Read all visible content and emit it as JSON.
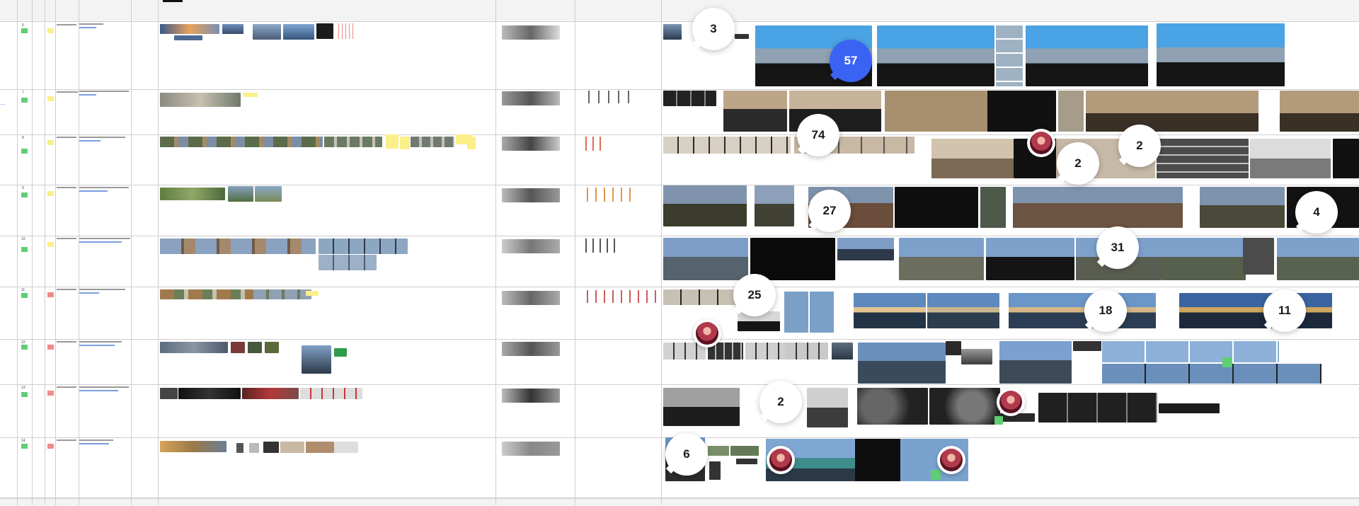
{
  "board": {
    "rows": [
      {
        "label": "6"
      },
      {
        "label": "7"
      },
      {
        "label": "8"
      },
      {
        "label": "9"
      },
      {
        "label": "10"
      },
      {
        "label": "11"
      },
      {
        "label": "12"
      },
      {
        "label": "13"
      },
      {
        "label": "14"
      }
    ]
  },
  "comments": [
    {
      "count": "3"
    },
    {
      "count": "57"
    },
    {
      "count": "74"
    },
    {
      "count": "2"
    },
    {
      "count": "2"
    },
    {
      "count": "27"
    },
    {
      "count": "4"
    },
    {
      "count": "31"
    },
    {
      "count": "25"
    },
    {
      "count": "18"
    },
    {
      "count": "11"
    },
    {
      "count": "2"
    },
    {
      "count": "6"
    }
  ],
  "colors": {
    "accent": "#3b63f3",
    "status_green": "#5fce74",
    "status_yellow": "#fbef8a",
    "status_red": "#f28a8a",
    "grid": "#cfcfcf"
  }
}
